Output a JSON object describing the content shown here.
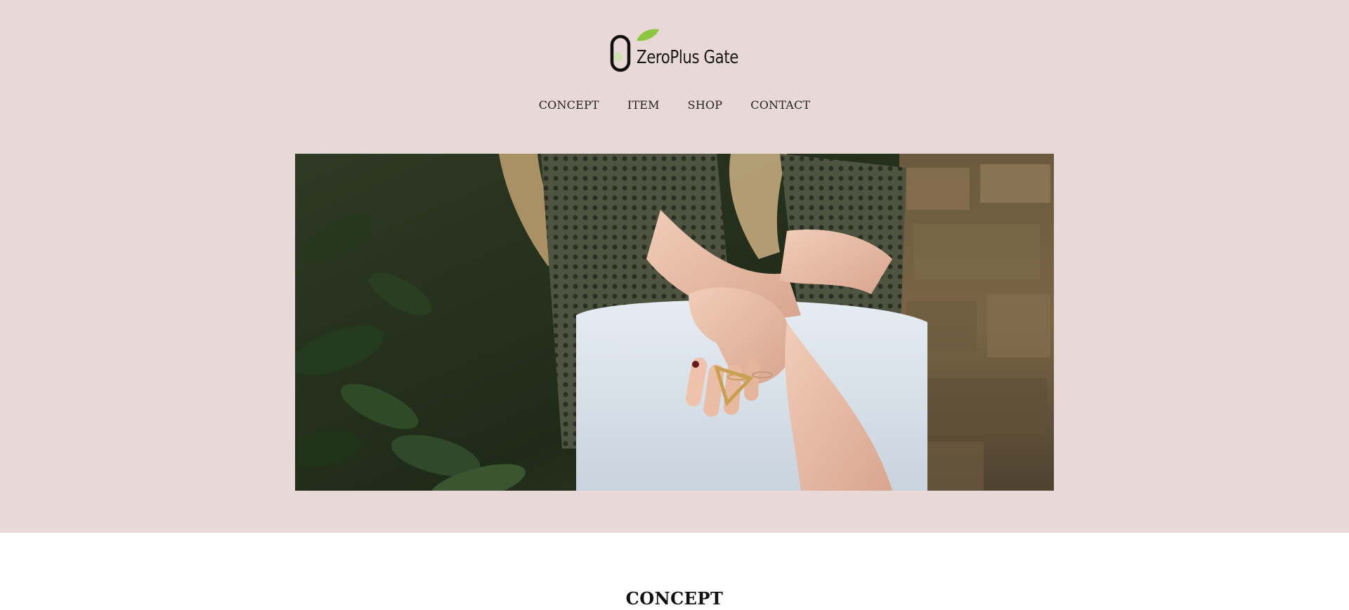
{
  "brand": {
    "name": "ZeroPlus Gate",
    "logo_colors": {
      "ring": "#111111",
      "leaf": "#8cc63f",
      "dot": "#cfe3b0"
    }
  },
  "nav": {
    "items": [
      {
        "label": "CONCEPT"
      },
      {
        "label": "ITEM"
      },
      {
        "label": "SHOP"
      },
      {
        "label": "CONTACT"
      }
    ]
  },
  "hero": {
    "image": "photo-woman-rings-cardigan"
  },
  "sections": {
    "concept_title": "CONCEPT"
  },
  "colors": {
    "header_bg": "#e8d8d7",
    "body_bg": "#ffffff"
  }
}
